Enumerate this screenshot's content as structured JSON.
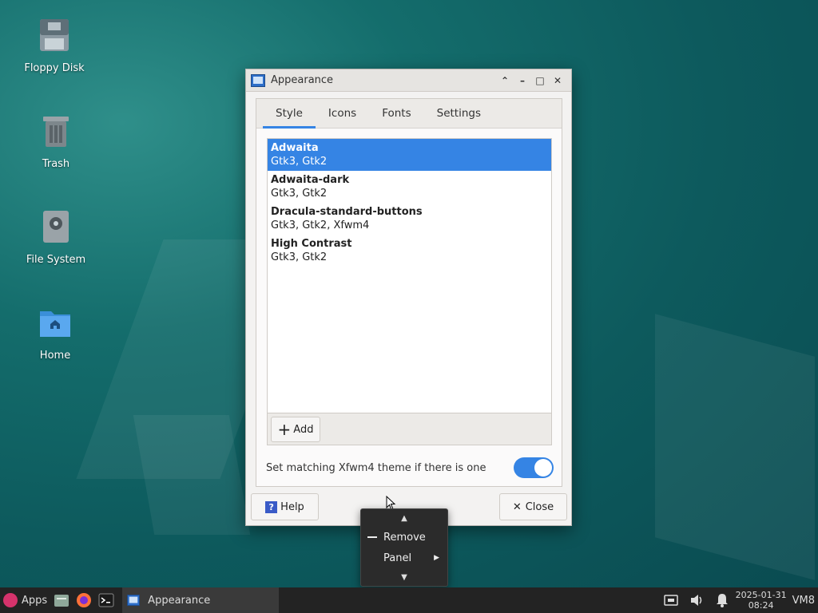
{
  "desktop": {
    "icons": [
      {
        "label": "Floppy Disk",
        "icon": "floppy-disk-icon"
      },
      {
        "label": "Trash",
        "icon": "trash-icon"
      },
      {
        "label": "File System",
        "icon": "drive-icon"
      },
      {
        "label": "Home",
        "icon": "home-folder-icon"
      }
    ]
  },
  "window": {
    "title": "Appearance",
    "tabs": [
      "Style",
      "Icons",
      "Fonts",
      "Settings"
    ],
    "active_tab": "Style",
    "themes": [
      {
        "name": "Adwaita",
        "types": "Gtk3, Gtk2",
        "selected": true
      },
      {
        "name": "Adwaita-dark",
        "types": "Gtk3, Gtk2",
        "selected": false
      },
      {
        "name": "Dracula-standard-buttons",
        "types": "Gtk3, Gtk2, Xfwm4",
        "selected": false
      },
      {
        "name": "High Contrast",
        "types": "Gtk3, Gtk2",
        "selected": false
      }
    ],
    "add_label": "Add",
    "match_label": "Set matching Xfwm4 theme if there is one",
    "match_enabled": true,
    "help_label": "Help",
    "close_label": "Close"
  },
  "context_menu": {
    "items": [
      {
        "label": "Remove"
      },
      {
        "label": "Panel"
      }
    ]
  },
  "taskbar": {
    "apps_label": "Apps",
    "task_label": "Appearance",
    "date": "2025-01-31",
    "time": "08:24",
    "user": "VM8"
  },
  "colors": {
    "accent": "#3584e4",
    "panel": "#232323"
  }
}
